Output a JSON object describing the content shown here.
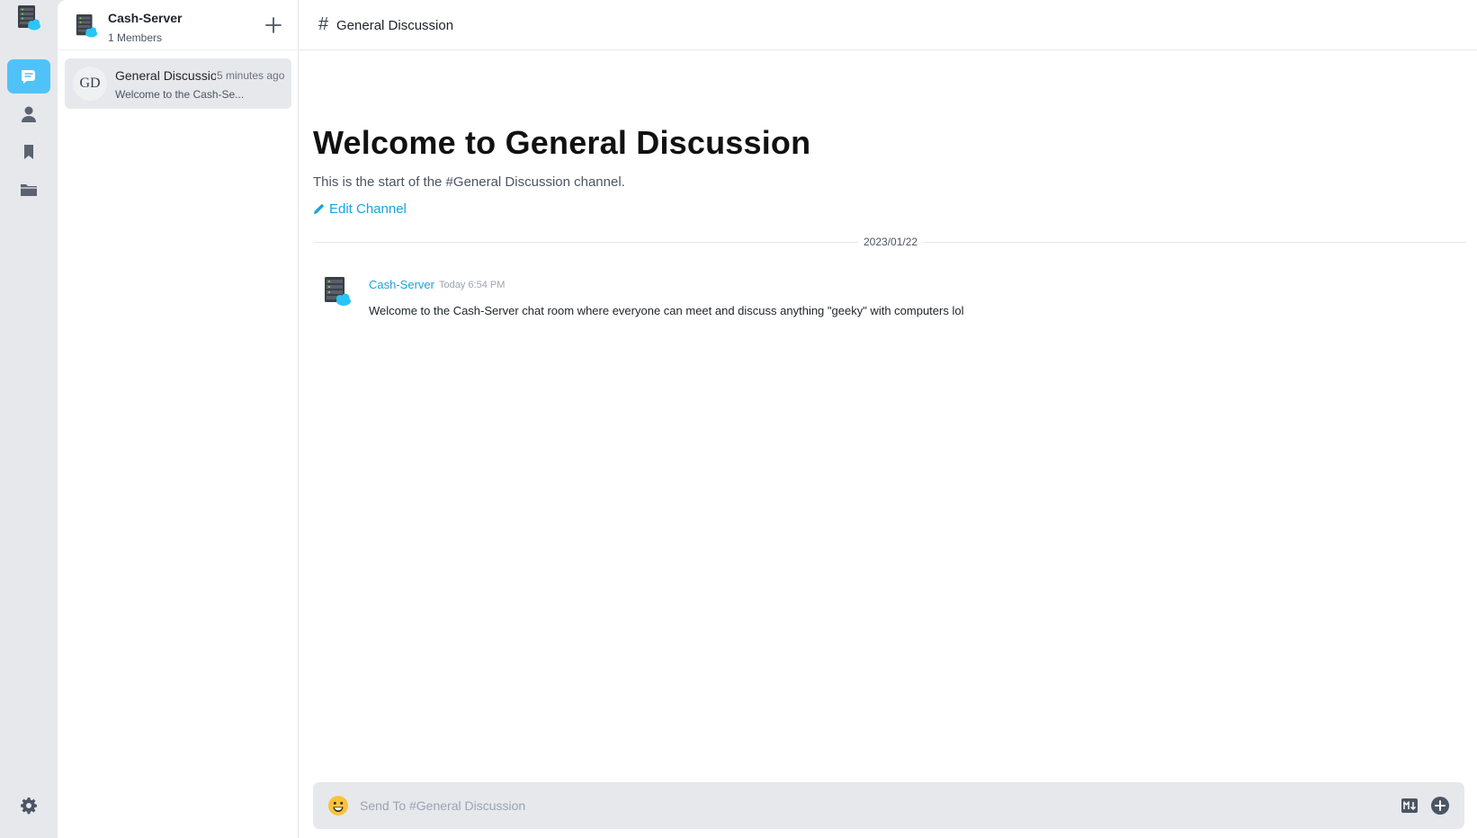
{
  "rail": {
    "items": [
      {
        "name": "chat-bubble-icon",
        "active": true
      },
      {
        "name": "user-icon",
        "active": false
      },
      {
        "name": "bookmark-icon",
        "active": false
      },
      {
        "name": "folder-icon",
        "active": false
      }
    ],
    "settings_icon": "gear-icon"
  },
  "server": {
    "name": "Cash-Server",
    "members": "1 Members"
  },
  "channels": [
    {
      "avatar_initials": "GD",
      "title": "General Discussion",
      "time": "5 minutes ago",
      "preview": "Welcome to the Cash-Se..."
    }
  ],
  "header": {
    "hash": "#",
    "title": "General Discussion"
  },
  "welcome": {
    "title": "Welcome to General Discussion",
    "subtitle": "This is the start of the #General Discussion channel.",
    "edit_label": "Edit Channel"
  },
  "date_divider": "2023/01/22",
  "messages": [
    {
      "author": "Cash-Server",
      "time": "Today 6:54 PM",
      "text": "Welcome to the Cash-Server chat room where everyone can meet and discuss anything \"geeky\" with computers lol"
    }
  ],
  "composer": {
    "placeholder": "Send To #General Discussion"
  },
  "colors": {
    "accent": "#4fc3f7",
    "link": "#1aa3d9",
    "rail_bg": "#e6e8ec"
  }
}
